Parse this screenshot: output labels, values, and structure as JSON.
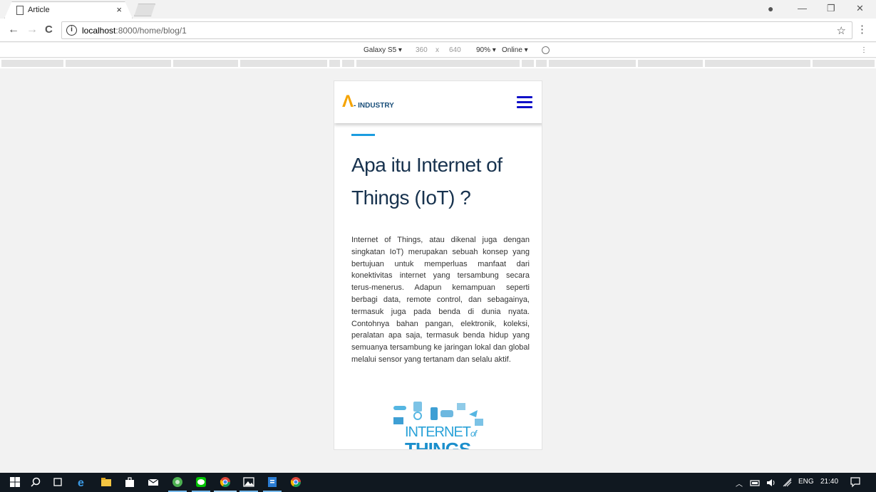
{
  "browser": {
    "tab_title": "Article",
    "tab_close": "×",
    "url_host": "localhost",
    "url_path": ":8000/home/blog/1",
    "info_icon": "i",
    "back": "←",
    "forward": "→",
    "reload": "C",
    "star": "☆",
    "menu": "⋮",
    "profile": "●",
    "minimize": "—",
    "restore": "❐",
    "close": "✕"
  },
  "devtools": {
    "device": "Galaxy S5 ▾",
    "width": "360",
    "times": "x",
    "height": "640",
    "zoom": "90% ▾",
    "network": "Online ▾",
    "menu": "⋮"
  },
  "site": {
    "logo_mark": "Λ",
    "logo_text": "- INDUSTRY",
    "article_title": "Apa itu Internet of Things (IoT) ?",
    "article_body": "Internet of Things, atau dikenal juga dengan singkatan IoT) merupakan sebuah konsep yang bertujuan untuk memperluas manfaat dari konektivitas internet yang tersambung secara terus-menerus. Adapun kemampuan seperti berbagi data, remote control, dan sebagainya, termasuk juga pada benda di dunia nyata. Contohnya bahan pangan, elektronik, koleksi, peralatan apa saja, termasuk benda hidup yang semuanya tersambung ke jaringan lokal dan global melalui sensor yang tertanam dan selalu aktif.",
    "image_word1": "INTERNET",
    "image_word2": "of",
    "image_word3": "THINGS"
  },
  "taskbar": {
    "lang": "ENG",
    "time": "21:40"
  }
}
